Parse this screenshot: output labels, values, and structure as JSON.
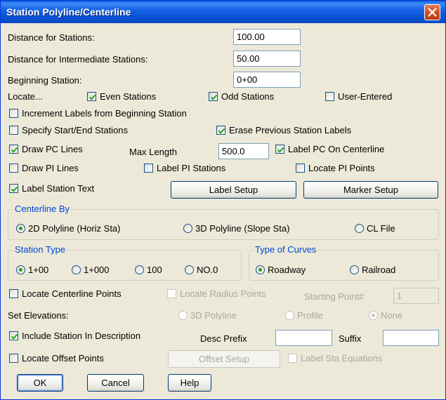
{
  "window": {
    "title": "Station Polyline/Centerline"
  },
  "fields": {
    "distance_stations": {
      "label": "Distance for Stations:",
      "value": "100.00"
    },
    "distance_intermediate": {
      "label": "Distance for Intermediate Stations:",
      "value": "50.00"
    },
    "beginning_station": {
      "label": "Beginning Station:",
      "value": "0+00"
    }
  },
  "locate": {
    "label": "Locate...",
    "even": {
      "label": "Even Stations",
      "checked": true
    },
    "odd": {
      "label": "Odd Stations",
      "checked": true
    },
    "user": {
      "label": "User-Entered",
      "checked": false
    }
  },
  "options": {
    "increment_labels": {
      "label": "Increment Labels from Beginning Station",
      "checked": false
    },
    "specify_start_end": {
      "label": "Specify Start/End Stations",
      "checked": false
    },
    "erase_previous": {
      "label": "Erase Previous Station Labels",
      "checked": true
    },
    "draw_pc_lines": {
      "label": "Draw PC Lines",
      "checked": true
    },
    "max_length": {
      "label": "Max Length",
      "value": "500.0"
    },
    "label_pc_centerline": {
      "label": "Label PC On Centerline",
      "checked": true
    },
    "draw_pi_lines": {
      "label": "Draw PI Lines",
      "checked": false
    },
    "label_pi_stations": {
      "label": "Label PI Stations",
      "checked": false
    },
    "locate_pi_points": {
      "label": "Locate PI Points",
      "checked": false
    },
    "label_station_text": {
      "label": "Label Station Text",
      "checked": true
    }
  },
  "buttons": {
    "label_setup": "Label Setup",
    "marker_setup": "Marker Setup",
    "offset_setup": "Offset Setup",
    "ok": "OK",
    "cancel": "Cancel",
    "help": "Help"
  },
  "centerline_by": {
    "title": "Centerline By",
    "options": [
      "2D Polyline (Horiz Sta)",
      "3D Polyline (Slope Sta)",
      "CL File"
    ],
    "selected": "2D Polyline (Horiz Sta)"
  },
  "station_type": {
    "title": "Station Type",
    "options": [
      "1+00",
      "1+000",
      "100",
      "NO.0"
    ],
    "selected": "1+00"
  },
  "type_of_curves": {
    "title": "Type of Curves",
    "options": [
      "Roadway",
      "Railroad"
    ],
    "selected": "Roadway"
  },
  "centerline_points": {
    "locate_centerline_points": {
      "label": "Locate Centerline Points",
      "checked": false
    },
    "locate_radius_points": {
      "label": "Locate Radius Points",
      "checked": false,
      "disabled": true
    },
    "starting_point": {
      "label": "Starting Point#",
      "value": "1"
    }
  },
  "set_elevations": {
    "label": "Set Elevations:",
    "options": [
      "3D Polyline",
      "Profile",
      "None"
    ],
    "selected": "None"
  },
  "description": {
    "include_station": {
      "label": "Include Station In Description",
      "checked": true
    },
    "desc_prefix": {
      "label": "Desc Prefix",
      "value": ""
    },
    "suffix": {
      "label": "Suffix",
      "value": ""
    }
  },
  "offset": {
    "locate_offset_points": {
      "label": "Locate Offset Points",
      "checked": false
    },
    "label_sta_equations": {
      "label": "Label Sta Equations",
      "checked": false,
      "disabled": true
    }
  }
}
